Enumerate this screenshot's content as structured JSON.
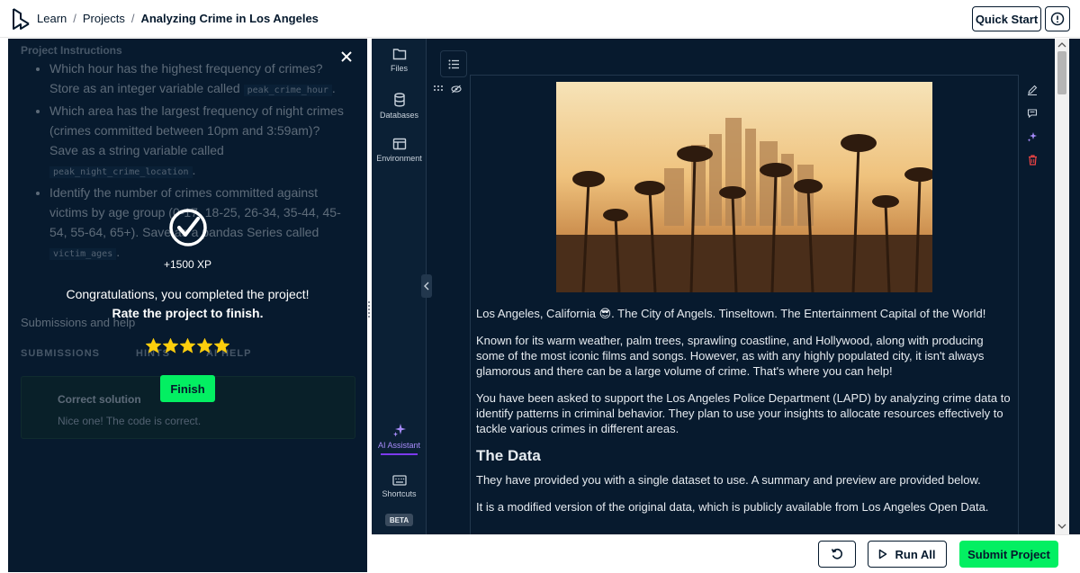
{
  "breadcrumb": {
    "items": [
      "Learn",
      "Projects"
    ],
    "current": "Analyzing Crime in Los Angeles",
    "separator": "/"
  },
  "header": {
    "quick_start_label": "Quick Start"
  },
  "instructions": {
    "panel_title": "Project Instructions",
    "tasks": [
      {
        "text": "Which hour has the highest frequency of crimes? Store as an integer variable called",
        "code": "peak_crime_hour"
      },
      {
        "text": "Which area has the largest frequency of night crimes (crimes committed between 10pm and 3:59am)? Save as a string variable called",
        "code": "peak_night_crime_location"
      },
      {
        "text": "Identify the number of crimes committed against victims by age group (0-17, 18-25, 26-34, 35-44, 45-54, 55-64, 65+). Save as a pandas Series called",
        "code": "victim_ages"
      }
    ],
    "submissions_label": "Submissions and help",
    "tabs": [
      "SUBMISSIONS",
      "HINTS",
      "AI HELP"
    ],
    "result_title": "Correct solution",
    "result_text": "Nice one! The code is correct."
  },
  "completion": {
    "xp": "+1500 XP",
    "message": "Congratulations, you completed the project!",
    "prompt": "Rate the project to finish.",
    "rating": 5,
    "finish_label": "Finish"
  },
  "rail": {
    "files": "Files",
    "databases": "Databases",
    "environment": "Environment",
    "ai_assistant": "AI Assistant",
    "shortcuts": "Shortcuts",
    "beta": "BETA"
  },
  "notebook": {
    "intro": "Los Angeles, California 😎. The City of Angels. Tinseltown. The Entertainment Capital of the World!",
    "p1": "Known for its warm weather, palm trees, sprawling coastline, and Hollywood, along with producing some of the most iconic films and songs. However, as with any highly populated city, it isn't always glamorous and there can be a large volume of crime. That's where you can help!",
    "p2": "You have been asked to support the Los Angeles Police Department (LAPD) by analyzing crime data to identify patterns in criminal behavior. They plan to use your insights to allocate resources effectively to tackle various crimes in different areas.",
    "heading": "The Data",
    "p3": "They have provided you with a single dataset to use. A summary and preview are provided below.",
    "p4": "It is a modified version of the original data, which is publicly available from Los Angeles Open Data."
  },
  "actions": {
    "run_all": "Run All",
    "submit": "Submit Project"
  },
  "colors": {
    "accent_green": "#03ef62",
    "panel_navy": "#071a2e",
    "ai_purple": "#a78bfa"
  }
}
